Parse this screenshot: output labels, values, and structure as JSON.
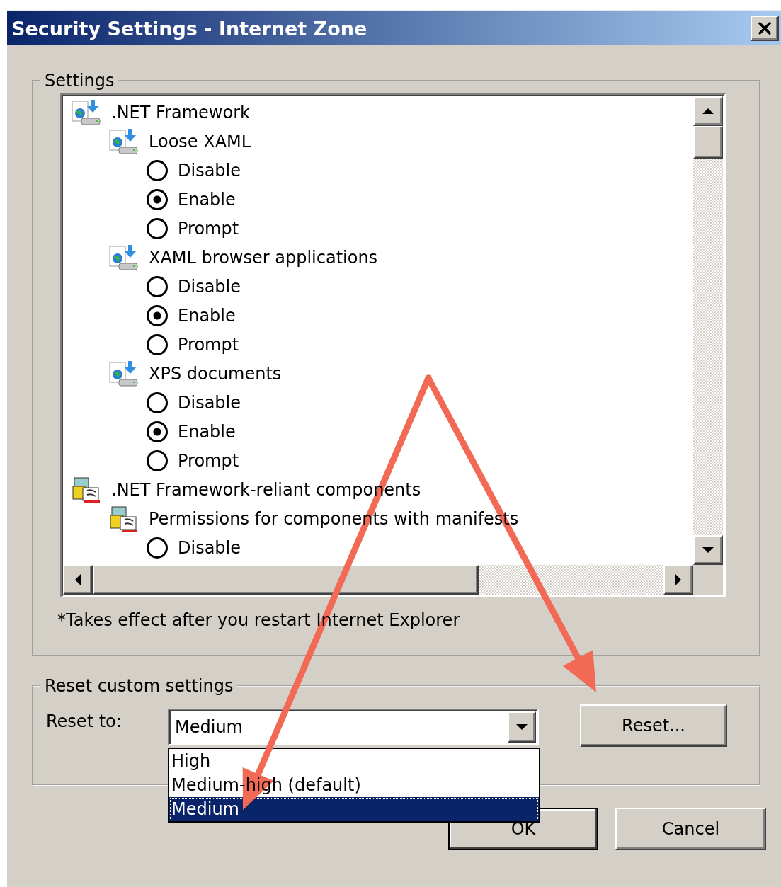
{
  "window": {
    "title": "Security Settings - Internet Zone"
  },
  "settings": {
    "legend": "Settings",
    "tree": [
      {
        "kind": "download-setting",
        "label": ".NET Framework",
        "children": [
          {
            "kind": "download-setting",
            "label": "Loose XAML",
            "children": [
              {
                "kind": "radio",
                "label": "Disable",
                "selected": false
              },
              {
                "kind": "radio",
                "label": "Enable",
                "selected": true
              },
              {
                "kind": "radio",
                "label": "Prompt",
                "selected": false
              }
            ]
          },
          {
            "kind": "download-setting",
            "label": "XAML browser applications",
            "children": [
              {
                "kind": "radio",
                "label": "Disable",
                "selected": false
              },
              {
                "kind": "radio",
                "label": "Enable",
                "selected": true
              },
              {
                "kind": "radio",
                "label": "Prompt",
                "selected": false
              }
            ]
          },
          {
            "kind": "download-setting",
            "label": "XPS documents",
            "children": [
              {
                "kind": "radio",
                "label": "Disable",
                "selected": false
              },
              {
                "kind": "radio",
                "label": "Enable",
                "selected": true
              },
              {
                "kind": "radio",
                "label": "Prompt",
                "selected": false
              }
            ]
          }
        ]
      },
      {
        "kind": "component-setting",
        "label": ".NET Framework-reliant components",
        "children": [
          {
            "kind": "component-setting",
            "label": "Permissions for components with manifests",
            "children": [
              {
                "kind": "radio",
                "label": "Disable",
                "selected": false
              }
            ]
          }
        ]
      }
    ],
    "footnote": "*Takes effect after you restart Internet Explorer"
  },
  "reset": {
    "legend": "Reset custom settings",
    "label": "Reset to:",
    "combo": {
      "value": "Medium",
      "expanded": true,
      "options": [
        {
          "label": "High",
          "selected": false
        },
        {
          "label": "Medium-high (default)",
          "selected": false
        },
        {
          "label": "Medium",
          "selected": true
        }
      ]
    },
    "button": "Reset..."
  },
  "buttons": [
    {
      "label": "OK"
    },
    {
      "label": "Cancel"
    }
  ]
}
